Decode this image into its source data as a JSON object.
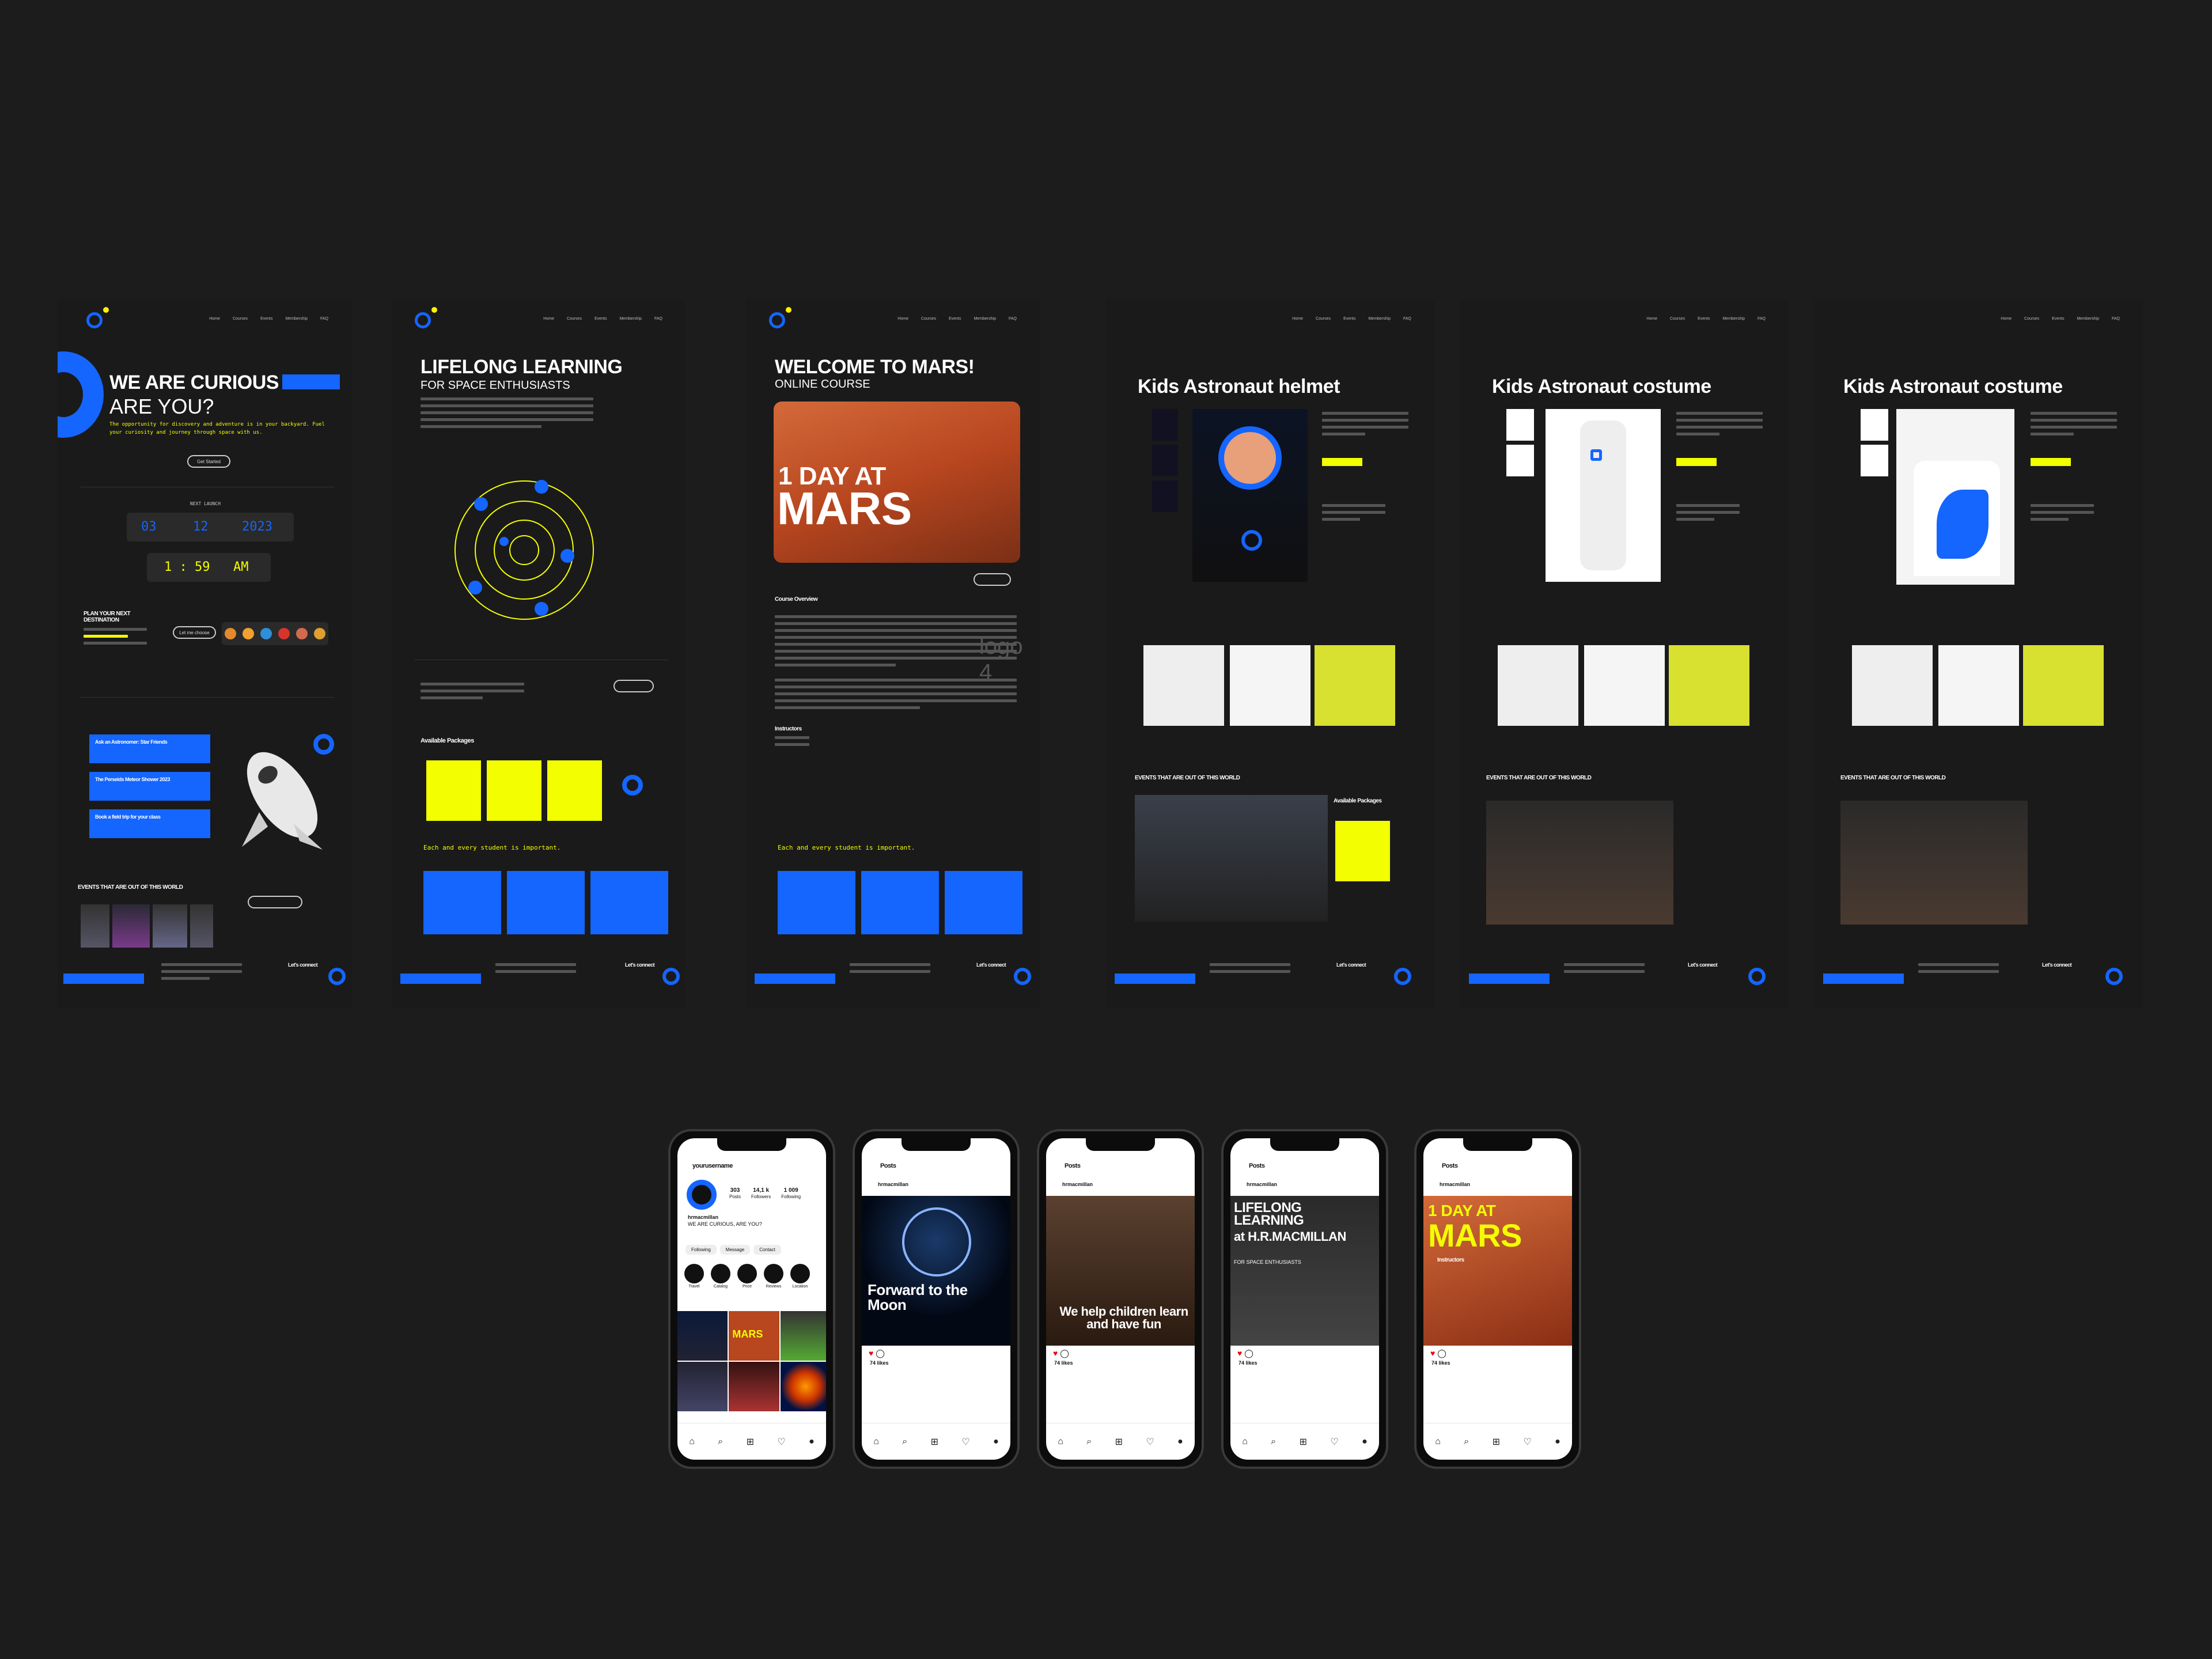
{
  "nav": {
    "links": [
      "Home",
      "Courses",
      "Events",
      "Membership",
      "FAQ"
    ]
  },
  "page1": {
    "title": "WE ARE CURIOUS",
    "title2": "ARE YOU?",
    "tagline": "The opportunity for discovery and adventure is in your backyard. Fuel your curiosity and journey through space with us.",
    "cta": "Get Started",
    "next_launch": "NEXT LAUNCH",
    "date": {
      "day": "03",
      "month": "12",
      "year": "2023"
    },
    "time": "1 : 59",
    "ampm": "AM",
    "plan_label": "PLAN YOUR NEXT DESTINATION",
    "plan_btn": "Let me choose",
    "events_title": "EVENTS THAT ARE OUT OF THIS WORLD",
    "items": [
      "Ask an Astronomer: Star Friends",
      "The Perseids Meteor Shower 2023",
      "Book a field trip for your class"
    ]
  },
  "page2": {
    "title": "LIFELONG LEARNING",
    "subtitle": "FOR SPACE ENTHUSIASTS",
    "packages": "Available Packages",
    "quote": "Each and every student is important."
  },
  "page3": {
    "title": "WELCOME TO MARS!",
    "subtitle": "ONLINE COURSE",
    "hero1": "1 DAY AT",
    "hero2": "MARS",
    "overview": "Course Overview",
    "watermark": "logo 4",
    "quote": "Each and every student is important.",
    "instructors": "Instructors"
  },
  "page4": {
    "title": "Kids Astronaut helmet",
    "events": "EVENTS THAT ARE OUT OF THIS WORLD",
    "packages": "Available Packages"
  },
  "page5": {
    "title": "Kids Astronaut costume",
    "events": "EVENTS THAT ARE OUT OF THIS WORLD"
  },
  "page6": {
    "title": "Kids Astronaut costume",
    "events": "EVENTS THAT ARE OUT OF THIS WORLD"
  },
  "footer": {
    "connect": "Let's connect"
  },
  "phones": {
    "p1": {
      "handle": "yourusername",
      "stats": [
        {
          "n": "303",
          "l": "Posts"
        },
        {
          "n": "14,1 k",
          "l": "Followers"
        },
        {
          "n": "1 009",
          "l": "Following"
        }
      ],
      "name": "hrmacmillan",
      "bio": "WE ARE CURIOUS, ARE YOU?",
      "btn1": "Following",
      "btn2": "Message",
      "btn3": "Contact",
      "highlights": [
        "Travel",
        "Catalog",
        "Price",
        "Reviews",
        "Location"
      ],
      "tile": "MARS"
    },
    "p2": {
      "header": "Posts",
      "account": "hrmacmillan",
      "caption": "Forward to the Moon",
      "likes": "74 likes"
    },
    "p3": {
      "header": "Posts",
      "account": "hrmacmillan",
      "caption": "We help children learn and have fun",
      "likes": "74 likes"
    },
    "p4": {
      "header": "Posts",
      "account": "hrmacmillan",
      "caption1": "LIFELONG LEARNING",
      "caption2": "at H.R.MACMILLAN",
      "caption3": "FOR SPACE ENTHUSIASTS",
      "likes": "74 likes"
    },
    "p5": {
      "header": "Posts",
      "account": "hrmacmillan",
      "caption1": "1 DAY AT",
      "caption2": "MARS",
      "caption3": "Instructors",
      "likes": "74 likes"
    }
  },
  "colors": {
    "bg": "#1c1c1c",
    "blue": "#1565ff",
    "yellow": "#f3ff00",
    "mars": "#c0522a"
  }
}
